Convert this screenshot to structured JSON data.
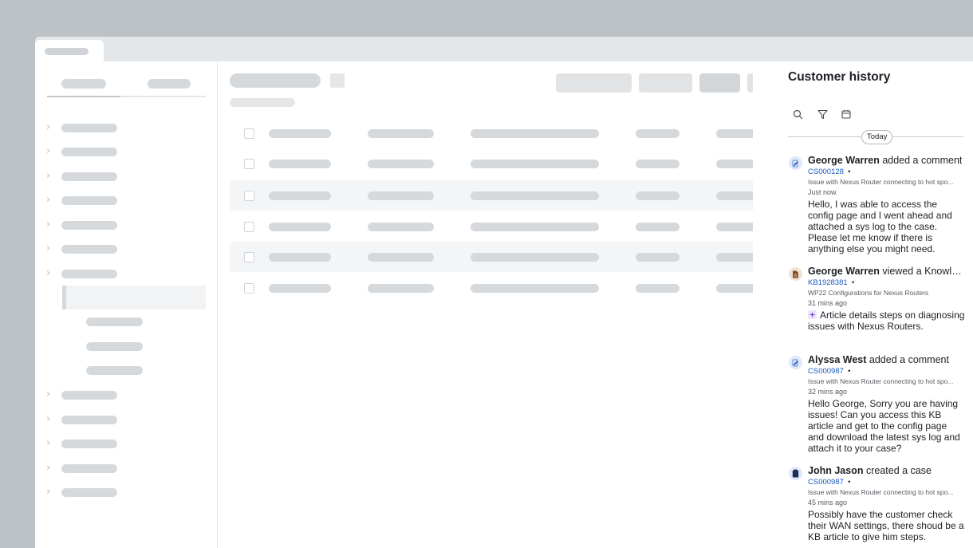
{
  "panel": {
    "title": "Customer history",
    "date_divider": "Today",
    "toolbar": {
      "icons": [
        "search-icon",
        "filter-icon",
        "calendar-icon"
      ]
    }
  },
  "entries": [
    {
      "actor": "George Warren",
      "action": "added a comment",
      "ref": "CS000128",
      "subject": "Issue with Nexus Router connecting to hot spo...",
      "time": "Just now",
      "body": "Hello, I was able to access the config page and I went ahead and attached a sys log to the case. Please let me know if there is anything else you might need.",
      "icon": "edit-icon"
    },
    {
      "actor": "George Warren",
      "action": "viewed a Knowled...",
      "ref": "KB1928381",
      "subject": "WP22 Configurations for Nexus Routers",
      "time": "31 mins ago",
      "body": "Article details steps on diagnosing issues with Nexus Routers.",
      "icon": "document-icon"
    },
    {
      "actor": "Alyssa West",
      "action": "added a comment",
      "ref": "CS000987",
      "subject": "Issue with Nexus Router connecting to hot spo...",
      "time": "32 mins ago",
      "body": "Hello George, Sorry you are having issues! Can you access this KB article and get to the config page and download the latest sys log and attach it to your case?",
      "icon": "edit-icon"
    },
    {
      "actor": "John Jason",
      "action": "created a case",
      "ref": "CS000987",
      "subject": "Issue with Nexus Router connecting to hot spo...",
      "time": "45 mins ago",
      "body": "Possibly have the customer check their WAN settings, there shoud be a KB article to give him steps.",
      "icon": "clipboard-icon"
    }
  ],
  "colors": {
    "link": "#1a5bbf",
    "skeleton": "#d6d9dc",
    "page_bg": "#bcc1c6"
  }
}
